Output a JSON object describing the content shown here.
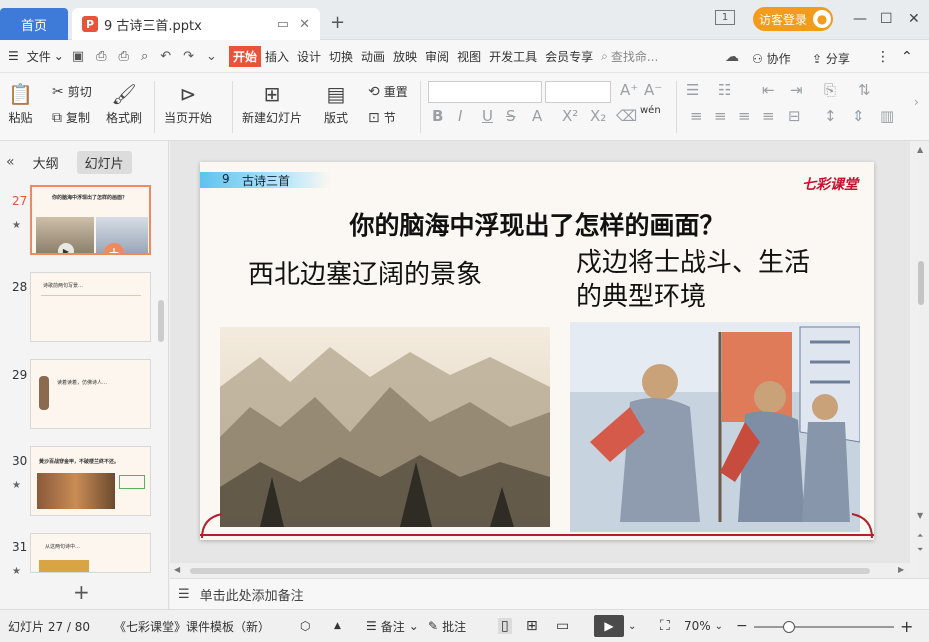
{
  "titlebar": {
    "home_tab": "首页",
    "doc_badge": "P",
    "doc_title": "9 古诗三首.pptx",
    "window_badge": "1",
    "login_label": "访客登录",
    "colors": {
      "home_tab": "#3e7bd8",
      "login": "#f29b1d",
      "ppt_badge": "#e8533a"
    }
  },
  "menubar": {
    "file": "文件",
    "start": "开始",
    "tabs": [
      "插入",
      "设计",
      "切换",
      "动画",
      "放映",
      "审阅",
      "视图",
      "开发工具",
      "会员专享"
    ],
    "search_placeholder": "查找命...",
    "collab": "协作",
    "share": "分享"
  },
  "ribbon": {
    "paste": "粘贴",
    "cut": "剪切",
    "copy": "复制",
    "format_painter": "格式刷",
    "from_start": "当页开始",
    "new_slide": "新建幻灯片",
    "layout": "版式",
    "reset": "重置",
    "section": "节",
    "font_tools": [
      "B",
      "I",
      "U",
      "S",
      "A",
      "X²",
      "X₂"
    ],
    "phonetic": "wén"
  },
  "left_panel": {
    "tab_outline": "大纲",
    "tab_slides": "幻灯片",
    "slides": [
      {
        "num": "27",
        "star": "★",
        "selected": true,
        "text": "你的脑海中浮现出了怎样的画面？"
      },
      {
        "num": "28",
        "star": "",
        "selected": false,
        "text": "诗歌前两句写景…"
      },
      {
        "num": "29",
        "star": "",
        "selected": false,
        "text": "读着读着，仿佛诗人…"
      },
      {
        "num": "30",
        "star": "★",
        "selected": false,
        "text": "黄沙百战穿金甲，不破楼兰终不还。"
      },
      {
        "num": "31",
        "star": "★",
        "selected": false,
        "text": "从这两句诗中…"
      }
    ]
  },
  "slide": {
    "header_num": "9",
    "header_title": "古诗三首",
    "logo": "七彩课堂",
    "title": "你的脑海中浮现出了怎样的画面？",
    "caption_left": "西北边塞辽阔的景象",
    "caption_right_line1": "戍边将士战斗、生活",
    "caption_right_line2": "的典型环境"
  },
  "notes": {
    "placeholder": "单击此处添加备注"
  },
  "statusbar": {
    "slide_counter": "幻灯片 27 / 80",
    "template": "《七彩课堂》课件模板（新）",
    "notes_btn": "备注",
    "comment_btn": "批注",
    "zoom": "70%",
    "zoom_level_percent": 70
  }
}
